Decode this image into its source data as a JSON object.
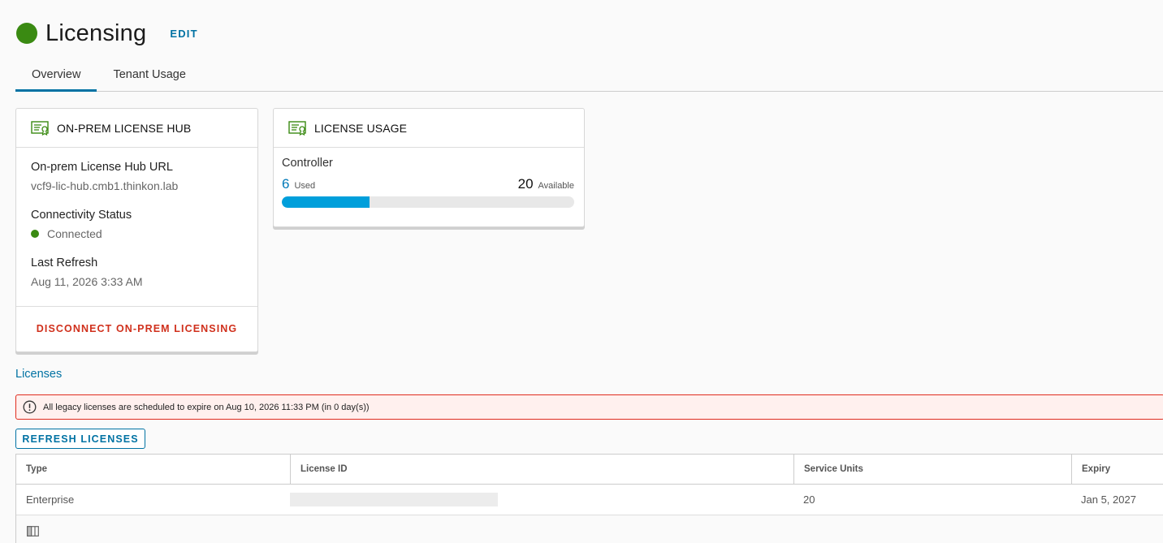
{
  "header": {
    "title": "Licensing",
    "edit_label": "EDIT",
    "status_color": "#3a8a12"
  },
  "tabs": [
    {
      "label": "Overview",
      "active": true
    },
    {
      "label": "Tenant Usage",
      "active": false
    }
  ],
  "hub_card": {
    "icon": "license-certificate-icon",
    "title": "ON-PREM LICENSE HUB",
    "url_label": "On-prem License Hub URL",
    "url_value": "vcf9-lic-hub.cmb1.thinkon.lab",
    "connectivity_label": "Connectivity Status",
    "connectivity_value": "Connected",
    "refresh_label": "Last Refresh",
    "refresh_value": "Aug 11, 2026 3:33 AM",
    "disconnect_label": "DISCONNECT ON-PREM LICENSING"
  },
  "usage_card": {
    "icon": "license-certificate-icon",
    "title": "LICENSE USAGE",
    "resource_label": "Controller",
    "used": "6",
    "used_label": "Used",
    "available": "20",
    "available_label": "Available",
    "fill_fraction": 0.3,
    "bar_color": "#009fdb"
  },
  "licenses": {
    "section_title": "Licenses",
    "alert_icon": "exclamation-circle-icon",
    "alert_text": "All legacy licenses are scheduled to expire on Aug 10, 2026 11:33 PM (in 0 day(s))",
    "refresh_button": "REFRESH LICENSES",
    "columns": [
      "Type",
      "License ID",
      "Service Units",
      "Expiry"
    ],
    "rows": [
      {
        "type": "Enterprise",
        "license_id": "",
        "service_units": "20",
        "expiry": "Jan 5, 2027"
      }
    ],
    "footer_icon": "column-toggle-icon"
  }
}
